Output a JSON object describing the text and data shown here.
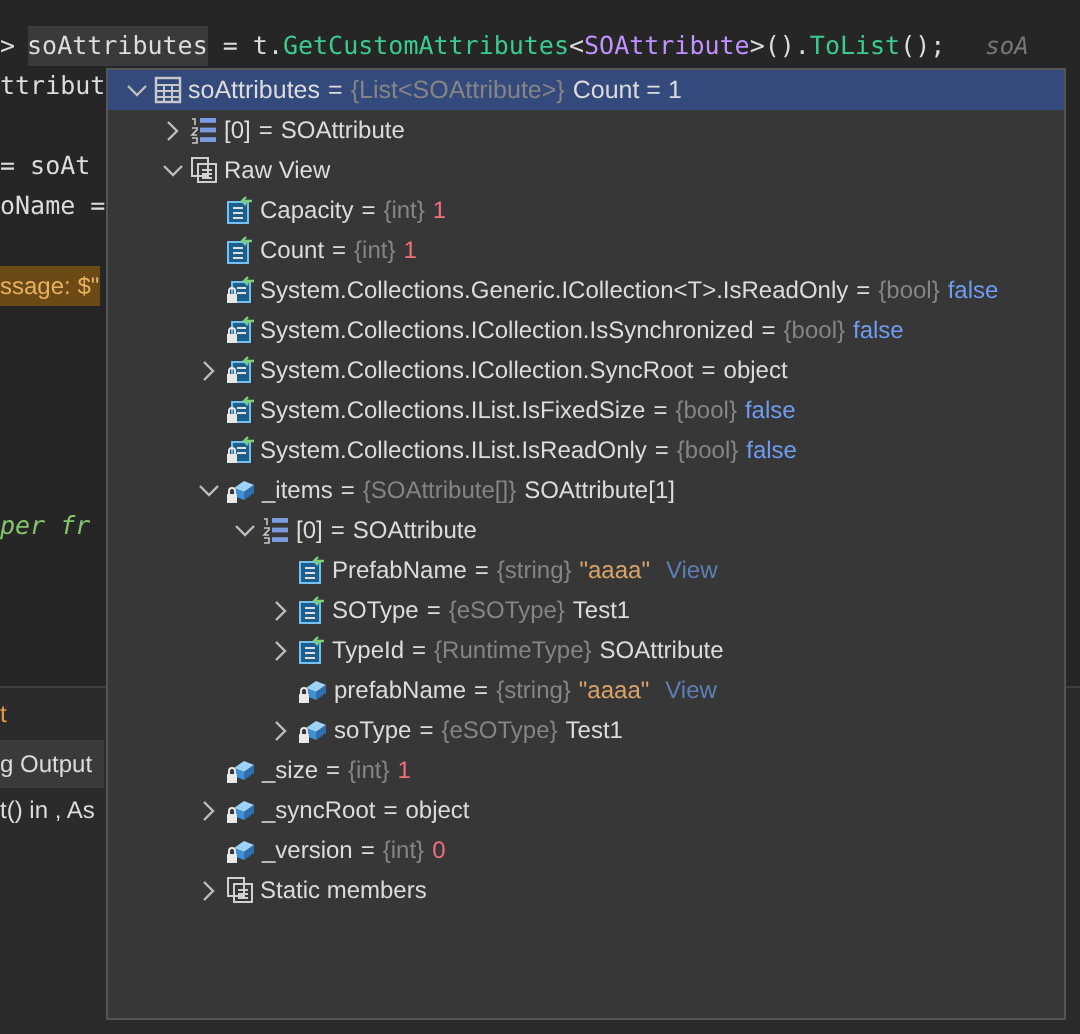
{
  "code_line": [
    {
      "kind": "plain",
      "text": ">"
    },
    {
      "kind": "highlight",
      "text": "soAttributes"
    },
    {
      "kind": "plain",
      "text": " = t."
    },
    {
      "kind": "method",
      "text": "GetCustomAttributes"
    },
    {
      "kind": "plain",
      "text": "<"
    },
    {
      "kind": "type",
      "text": "SOAttribute"
    },
    {
      "kind": "plain",
      "text": ">()."
    },
    {
      "kind": "method",
      "text": "ToList"
    },
    {
      "kind": "plain",
      "text": "();"
    },
    {
      "kind": "hint",
      "text": "soA"
    }
  ],
  "editor_lines": [
    {
      "kind": "code",
      "text": "ttribut"
    },
    {
      "kind": "blank"
    },
    {
      "kind": "code",
      "text": "= soAt"
    },
    {
      "kind": "code",
      "text": "oName ="
    },
    {
      "kind": "blank"
    },
    {
      "kind": "string",
      "text": "ssage: $\""
    },
    {
      "kind": "blank"
    },
    {
      "kind": "blank"
    },
    {
      "kind": "blank"
    },
    {
      "kind": "blank"
    },
    {
      "kind": "blank"
    },
    {
      "kind": "comment",
      "text": "per fr"
    }
  ],
  "bottom_panel": {
    "title": "t",
    "tab": "g Output",
    "rows": [
      "t() in , As"
    ]
  },
  "datatip": {
    "name": "soAttributes",
    "separator": "=",
    "type": "{List<SOAttribute>}",
    "value": {
      "kind": "plain",
      "text": "Count = 1"
    },
    "kind": "list",
    "expanded": true,
    "children": [
      {
        "name": "[0]",
        "separator": "=",
        "value": {
          "kind": "plain",
          "text": "SOAttribute"
        },
        "kind": "indexer",
        "expanded": false
      },
      {
        "name": "Raw View",
        "kind": "raw",
        "expanded": true,
        "children": [
          {
            "name": "Capacity",
            "separator": "=",
            "type": "{int}",
            "value": {
              "kind": "number",
              "text": "1"
            },
            "kind": "property"
          },
          {
            "name": "Count",
            "separator": "=",
            "type": "{int}",
            "value": {
              "kind": "number",
              "text": "1"
            },
            "kind": "property"
          },
          {
            "name": "System.Collections.Generic.ICollection<T>.IsReadOnly",
            "separator": "=",
            "type": "{bool}",
            "value": {
              "kind": "bool",
              "text": "false"
            },
            "kind": "property-locked"
          },
          {
            "name": "System.Collections.ICollection.IsSynchronized",
            "separator": "=",
            "type": "{bool}",
            "value": {
              "kind": "bool",
              "text": "false"
            },
            "kind": "property-locked"
          },
          {
            "name": "System.Collections.ICollection.SyncRoot",
            "separator": "=",
            "value": {
              "kind": "plain",
              "text": "object"
            },
            "kind": "property-locked",
            "expanded": false
          },
          {
            "name": "System.Collections.IList.IsFixedSize",
            "separator": "=",
            "type": "{bool}",
            "value": {
              "kind": "bool",
              "text": "false"
            },
            "kind": "property-locked"
          },
          {
            "name": "System.Collections.IList.IsReadOnly",
            "separator": "=",
            "type": "{bool}",
            "value": {
              "kind": "bool",
              "text": "false"
            },
            "kind": "property-locked"
          },
          {
            "name": "_items",
            "separator": "=",
            "type": "{SOAttribute[]}",
            "value": {
              "kind": "plain",
              "text": "SOAttribute[1]"
            },
            "kind": "field-locked",
            "expanded": true,
            "children": [
              {
                "name": "[0]",
                "separator": "=",
                "value": {
                  "kind": "plain",
                  "text": "SOAttribute"
                },
                "kind": "indexer",
                "expanded": true,
                "children": [
                  {
                    "name": "PrefabName",
                    "separator": "=",
                    "type": "{string}",
                    "value": {
                      "kind": "string",
                      "text": "\"aaaa\""
                    },
                    "link": "View",
                    "kind": "property"
                  },
                  {
                    "name": "SOType",
                    "separator": "=",
                    "type": "{eSOType}",
                    "value": {
                      "kind": "plain",
                      "text": "Test1"
                    },
                    "kind": "property",
                    "expanded": false
                  },
                  {
                    "name": "TypeId",
                    "separator": "=",
                    "type": "{RuntimeType}",
                    "value": {
                      "kind": "plain",
                      "text": "SOAttribute"
                    },
                    "kind": "property",
                    "expanded": false
                  },
                  {
                    "name": "prefabName",
                    "separator": "=",
                    "type": "{string}",
                    "value": {
                      "kind": "string",
                      "text": "\"aaaa\""
                    },
                    "link": "View",
                    "kind": "field-locked"
                  },
                  {
                    "name": "soType",
                    "separator": "=",
                    "type": "{eSOType}",
                    "value": {
                      "kind": "plain",
                      "text": "Test1"
                    },
                    "kind": "field-locked",
                    "expanded": false
                  }
                ]
              }
            ]
          },
          {
            "name": "_size",
            "separator": "=",
            "type": "{int}",
            "value": {
              "kind": "number",
              "text": "1"
            },
            "kind": "field-locked"
          },
          {
            "name": "_syncRoot",
            "separator": "=",
            "value": {
              "kind": "plain",
              "text": "object"
            },
            "kind": "field-locked",
            "expanded": false
          },
          {
            "name": "_version",
            "separator": "=",
            "type": "{int}",
            "value": {
              "kind": "number",
              "text": "0"
            },
            "kind": "field-locked"
          },
          {
            "name": "Static members",
            "kind": "raw",
            "expanded": false
          }
        ]
      }
    ]
  }
}
